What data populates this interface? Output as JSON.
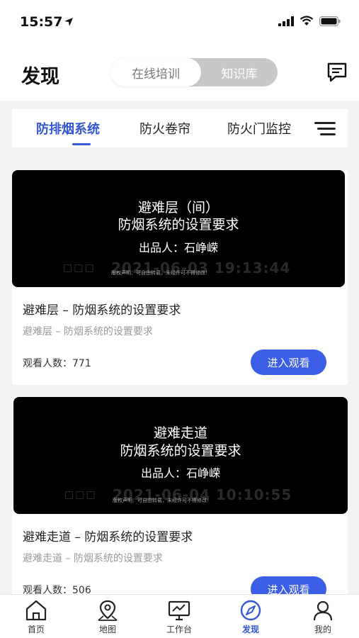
{
  "status": {
    "time": "15:57"
  },
  "header": {
    "title": "发现",
    "segments": [
      "在线培训",
      "知识库"
    ]
  },
  "categories": {
    "tabs": [
      "防排烟系统",
      "防火卷帘",
      "防火门监控"
    ]
  },
  "cards": [
    {
      "thumb_line1": "避难层（间）",
      "thumb_line2": "防烟系统的设置要求",
      "thumb_author": "出品人：石峥嵘",
      "thumb_timestamp": "2021-06-03 19:13:44",
      "thumb_boxes": "□□□",
      "thumb_note": "版权声明：可自由转载，未经许可不得修改！",
      "title": "避难层 – 防烟系统的设置要求",
      "subtitle": "避难层 – 防烟系统的设置要求",
      "views": "观看人数：771",
      "button": "进入观看"
    },
    {
      "thumb_line1": "避难走道",
      "thumb_line2": "防烟系统的设置要求",
      "thumb_author": "出品人：石峥嵘",
      "thumb_timestamp": "2021-06-04 10:10:55",
      "thumb_boxes": "□□□",
      "thumb_note": "版权声明：可自由转载，未经许可不得修改！",
      "title": "避难走道 – 防烟系统的设置要求",
      "subtitle": "避难走道 – 防烟系统的设置要求",
      "views": "观看人数：506",
      "button": "进入观看"
    }
  ],
  "tabbar": {
    "items": [
      "首页",
      "地图",
      "工作台",
      "发现",
      "我的"
    ],
    "active": "发现"
  },
  "colors": {
    "accent": "#3457d5",
    "button": "#3a5ee6"
  }
}
